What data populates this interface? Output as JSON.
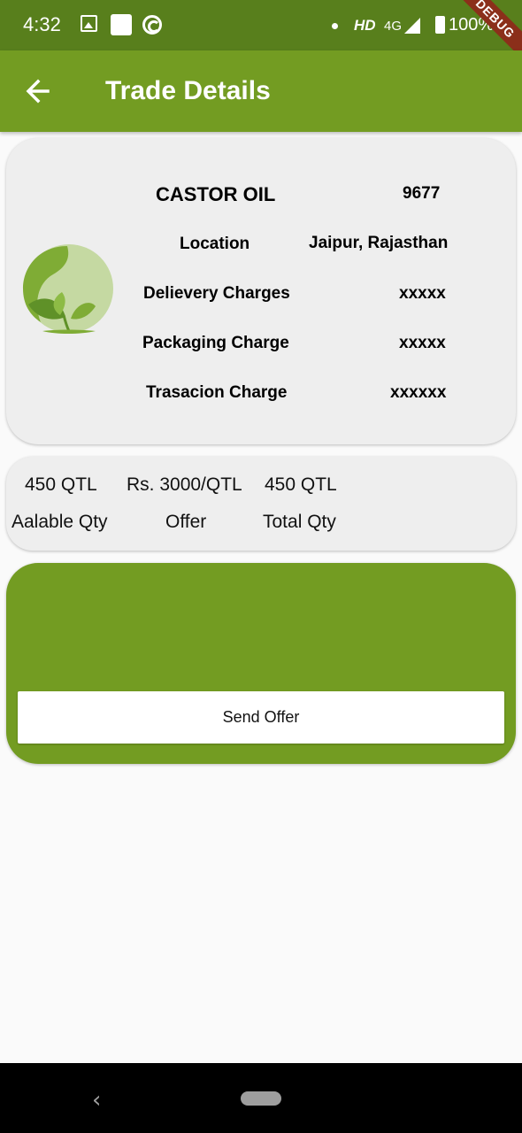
{
  "status_bar": {
    "time": "4:32",
    "hd": "HD",
    "network": "4G",
    "battery": "100%",
    "debug": "DEBUG",
    "icons": [
      "image-icon",
      "square-icon",
      "at-icon",
      "notification-dot-icon",
      "signal-icon",
      "battery-icon"
    ]
  },
  "app_bar": {
    "title": "Trade Details",
    "back_icon": "arrow-left-icon",
    "color": "#739c22"
  },
  "details": {
    "product_name": "CASTOR OIL",
    "product_id": "9677",
    "logo_icon": "plant-leaf-icon",
    "rows": [
      {
        "label": "Location",
        "value": "Jaipur, Rajasthan"
      },
      {
        "label": "Delievery Charges",
        "value": "xxxxx"
      },
      {
        "label": "Packaging Charge",
        "value": "xxxxx"
      },
      {
        "label": "Trasacion Charge",
        "value": "xxxxxx"
      }
    ]
  },
  "quantity": {
    "available_value": "450 QTL",
    "offer_value": "Rs. 3000/QTL",
    "total_value": "450 QTL",
    "available_label": "Aalable Qty",
    "offer_label": "Offer",
    "total_label": "Total Qty"
  },
  "offer": {
    "button_label": "Send Offer",
    "color": "#739c22"
  },
  "nav_bar": {
    "back_glyph": "‹",
    "icons": [
      "nav-back-icon",
      "nav-home-pill-icon"
    ]
  }
}
